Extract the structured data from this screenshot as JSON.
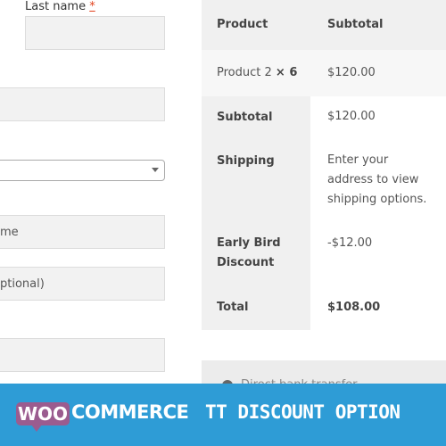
{
  "form": {
    "last_name_label": "Last name",
    "required_marker": "*",
    "country_select_value": "",
    "name_field_partial": "me",
    "optional_field_partial": "ptional)"
  },
  "order": {
    "headers": {
      "product": "Product",
      "subtotal": "Subtotal"
    },
    "item": {
      "name": "Product 2",
      "qty": "× 6",
      "price": "$120.00"
    },
    "subtotal": {
      "label": "Subtotal",
      "value": "$120.00"
    },
    "shipping": {
      "label": "Shipping",
      "value": "Enter your address to view shipping options."
    },
    "discount": {
      "label": "Early Bird Discount",
      "value": "-$12.00"
    },
    "total": {
      "label": "Total",
      "value": "$108.00"
    }
  },
  "payment": {
    "partial_option_text": "Direct bank transfer"
  },
  "banner": {
    "woo": "WOO",
    "commerce": "COMMERCE",
    "title": "TT DISCOUNT OPTION",
    "background": "#2e9cd6",
    "logo_color": "#9b5c8f"
  }
}
